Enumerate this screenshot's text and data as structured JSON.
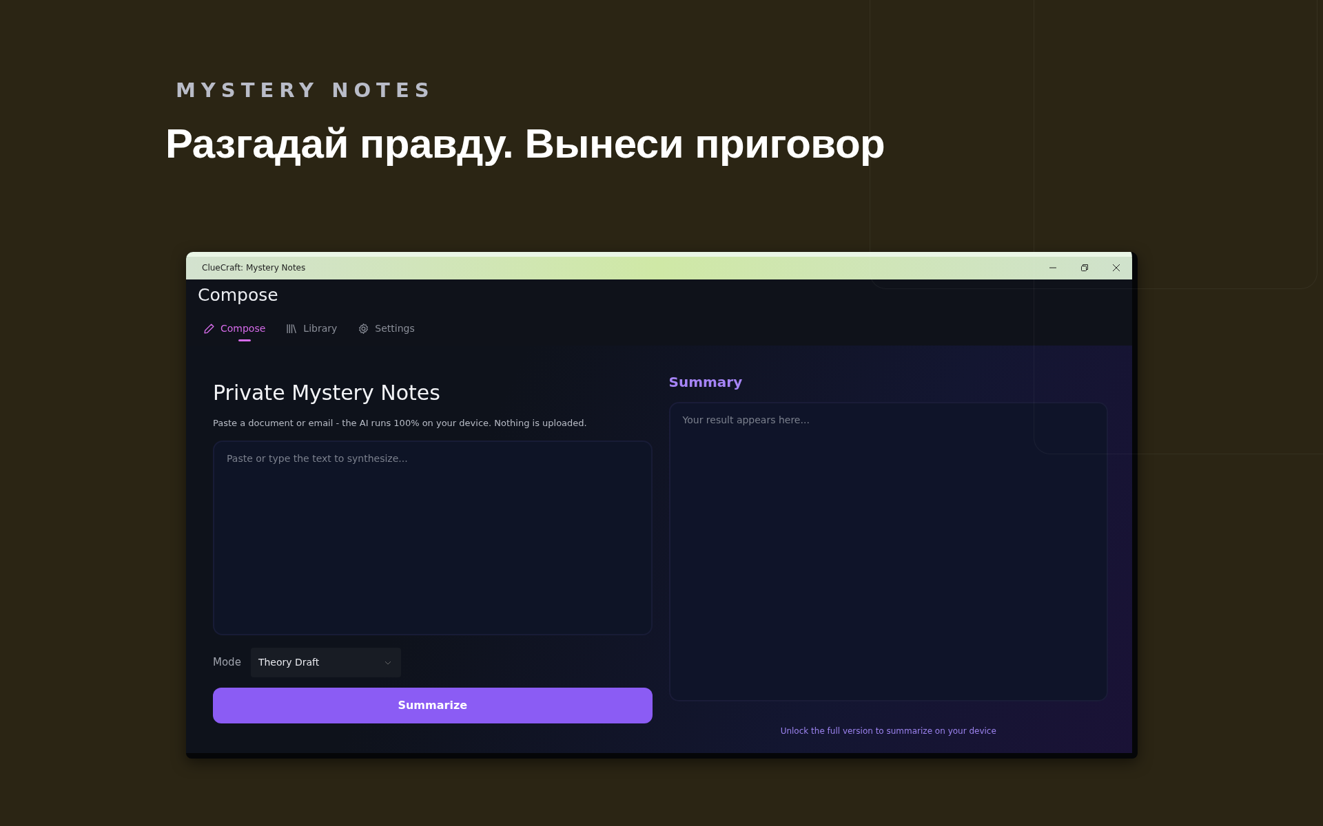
{
  "hero": {
    "eyebrow": "MYSTERY NOTES",
    "headline": "Разгадай правду. Вынеси приговор"
  },
  "window": {
    "title": "ClueCraft: Mystery Notes"
  },
  "page_title": "Compose",
  "tabs": [
    {
      "label": "Compose",
      "selected": true
    },
    {
      "label": "Library",
      "selected": false
    },
    {
      "label": "Settings",
      "selected": false
    }
  ],
  "compose": {
    "heading": "Private Mystery Notes",
    "description": "Paste a document or email - the AI runs 100% on your device. Nothing is uploaded.",
    "input": {
      "placeholder": "Paste or type the text to synthesize..."
    },
    "mode": {
      "label": "Mode",
      "value": "Theory Draft"
    },
    "button": "Summarize"
  },
  "summary": {
    "heading": "Summary",
    "output": {
      "placeholder": "Your result appears here..."
    },
    "notice": "Unlock the full version to summarize on your device"
  }
}
